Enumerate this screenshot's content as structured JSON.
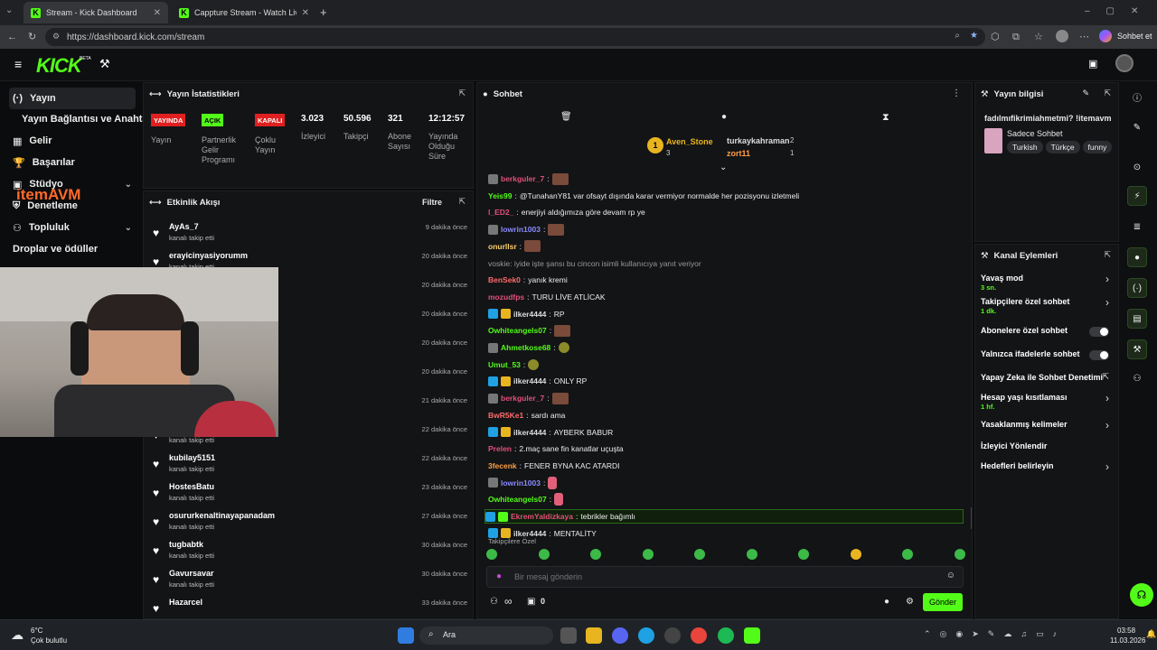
{
  "browser": {
    "tabs": [
      {
        "label": "Stream - Kick Dashboard",
        "active": true
      },
      {
        "label": "Cappture Stream - Watch Live on K",
        "active": false
      }
    ],
    "url": "https://dashboard.kick.com/stream",
    "profile_label": "Sohbet et"
  },
  "header": {
    "logo": "KICK",
    "logo_sup": "BETA"
  },
  "nav": {
    "items": [
      {
        "label": "Yayın"
      },
      {
        "label": "Yayın Bağlantısı ve Anahtarı"
      },
      {
        "label": "Gelir"
      },
      {
        "label": "Başarılar"
      },
      {
        "label": "Stüdyo"
      },
      {
        "label": "Denetleme"
      },
      {
        "label": "Topluluk"
      },
      {
        "label": "Droplar ve ödüller"
      }
    ],
    "overlay_logo": "itemAVM"
  },
  "stats": {
    "title": "Yayın İstatistikleri",
    "badges": [
      {
        "label": "YAYINDA",
        "caption": "Yayın"
      },
      {
        "label": "AÇIK",
        "caption": "Partnerlik Gelir Programı"
      },
      {
        "label": "KAPALI",
        "caption": "Çoklu Yayın"
      }
    ],
    "viewers": {
      "value": "3.023",
      "label": "İzleyici"
    },
    "followers": {
      "value": "50.596",
      "label": "Takipçi"
    },
    "subs": {
      "value": "321",
      "label": "Abone Sayısı"
    },
    "uptime": {
      "value": "12:12:57",
      "label": "Yayında Olduğu Süre"
    }
  },
  "activity": {
    "title": "Etkinlik Akışı",
    "filter_label": "Filtre",
    "items": [
      {
        "name": "AyAs_7",
        "action": "kanalı takip etti",
        "time": "9 dakika önce"
      },
      {
        "name": "erayicinyasiyorumm",
        "action": "kanalı takip etti",
        "time": "20 dakika önce"
      },
      {
        "name": "",
        "action": "",
        "time": "20 dakika önce"
      },
      {
        "name": "",
        "action": "",
        "time": "20 dakika önce"
      },
      {
        "name": "",
        "action": "",
        "time": "20 dakika önce"
      },
      {
        "name": "",
        "action": "",
        "time": "20 dakika önce"
      },
      {
        "name": "",
        "action": "",
        "time": "21 dakika önce"
      },
      {
        "name": "",
        "action": "kanalı takip etti",
        "time": "22 dakika önce"
      },
      {
        "name": "kubilay5151",
        "action": "kanalı takip etti",
        "time": "22 dakika önce"
      },
      {
        "name": "HostesBatu",
        "action": "kanalı takip etti",
        "time": "23 dakika önce"
      },
      {
        "name": "osururkenaltinayapanadam",
        "action": "kanalı takip etti",
        "time": "27 dakika önce"
      },
      {
        "name": "tugbabtk",
        "action": "kanalı takip etti",
        "time": "30 dakika önce"
      },
      {
        "name": "Gavursavar",
        "action": "kanalı takip etti",
        "time": "30 dakika önce"
      },
      {
        "name": "Hazarcel",
        "action": "",
        "time": "33 dakika önce"
      }
    ]
  },
  "chat": {
    "title": "Sohbet",
    "leaderboard": [
      {
        "name": "Aven_Stone",
        "count": "3"
      },
      {
        "name": "turkaykahraman",
        "count": "2"
      },
      {
        "name": "zort11",
        "count": "1"
      }
    ],
    "messages": [
      {
        "user": "berkguler_7",
        "color": "#e0507a",
        "text": ""
      },
      {
        "user": "Yeis99",
        "color": "#53fc18",
        "text": "@TunahanY81 var ofsayt dışında karar vermiyor normalde her pozisyonu izletmeli"
      },
      {
        "user": "l_ED2_",
        "color": "#e0507a",
        "text": "enerjiyi aldığımıza göre devam rp ye"
      },
      {
        "user": "lowrin1003",
        "color": "#8a8aff",
        "text": ""
      },
      {
        "user": "onurllsr",
        "color": "#ffcf6a",
        "text": ""
      },
      {
        "user": "",
        "color": "#999",
        "text": "voskie: iyide işte şansı bu cincon isimli kullanıcıya yanıt veriyor"
      },
      {
        "user": "BenSek0",
        "color": "#ff6b6b",
        "text": "yanık kremi"
      },
      {
        "user": "mozudfps",
        "color": "#e0507a",
        "text": "TURU LİVE ATLİCAK"
      },
      {
        "user": "ilker4444",
        "color": "#ddd",
        "text": "RP"
      },
      {
        "user": "Owhiteangels07",
        "color": "#53fc18",
        "text": ""
      },
      {
        "user": "Ahmetkose68",
        "color": "#53fc18",
        "text": ""
      },
      {
        "user": "Umut_53",
        "color": "#53fc18",
        "text": ""
      },
      {
        "user": "ilker4444",
        "color": "#ddd",
        "text": "ONLY RP"
      },
      {
        "user": "berkguler_7",
        "color": "#e0507a",
        "text": ""
      },
      {
        "user": "BwR5Ke1",
        "color": "#ff6b6b",
        "text": "sardı ama"
      },
      {
        "user": "ilker4444",
        "color": "#ddd",
        "text": "AYBERK BABUR"
      },
      {
        "user": "Prelen",
        "color": "#e0507a",
        "text": "2.maç sane fin kanatlar uçuşta"
      },
      {
        "user": "3fecenk",
        "color": "#ff9f43",
        "text": "FENER BYNA KAC ATARDI"
      },
      {
        "user": "lowrin1003",
        "color": "#8a8aff",
        "text": ""
      },
      {
        "user": "Owhiteangels07",
        "color": "#53fc18",
        "text": ""
      },
      {
        "user": "EkremYaldizkaya",
        "color": "#e0507a",
        "text": "tebrikler bağımlı"
      },
      {
        "user": "ilker4444",
        "color": "#ddd",
        "text": "MENTALİTY"
      }
    ],
    "followers_only_label": "Takipçilere Özel",
    "input_placeholder": "Bir mesaj gönderin",
    "infinity": "∞",
    "count_zero": "0",
    "send_label": "Gönder"
  },
  "stream_info": {
    "title": "Yayın bilgisi",
    "stream_title": "fadılmıfikrimiahmetmi? !itemavm",
    "category": "Sadece Sohbet",
    "tags": [
      "Turkish",
      "Türkçe",
      "funny"
    ]
  },
  "channel_actions": {
    "title": "Kanal Eylemleri",
    "rows": [
      {
        "label": "Yavaş mod",
        "sub": "3 sn.",
        "control": "chevron"
      },
      {
        "label": "Takipçilere özel sohbet",
        "sub": "1 dk.",
        "control": "chevron"
      },
      {
        "label": "Abonelere özel sohbet",
        "sub": "",
        "control": "toggle"
      },
      {
        "label": "Yalnızca ifadelerle sohbet",
        "sub": "",
        "control": "toggle"
      },
      {
        "label": "Yapay Zeka ile Sohbet Denetimi",
        "sub": "",
        "control": "link"
      },
      {
        "label": "Hesap yaşı kısıtlaması",
        "sub": "1 hf.",
        "control": "chevron"
      },
      {
        "label": "Yasaklanmış kelimeler",
        "sub": "",
        "control": "chevron"
      },
      {
        "label": "İzleyici Yönlendir",
        "sub": "",
        "control": "none"
      },
      {
        "label": "Hedefleri belirleyin",
        "sub": "",
        "control": "chevron"
      }
    ]
  },
  "taskbar": {
    "weather_temp": "6°C",
    "weather_desc": "Çok bulutlu",
    "search_label": "Ara",
    "time": "03:58",
    "date": "11.03.2026"
  },
  "colors": {
    "accent": "#53fc18",
    "live_red": "#e02020"
  }
}
